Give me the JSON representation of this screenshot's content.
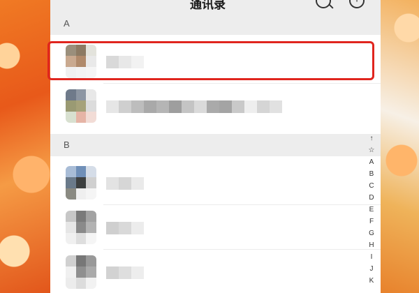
{
  "header": {
    "title": "通讯录",
    "search_icon": "search-icon",
    "add_icon": "add-icon",
    "add_glyph": "+"
  },
  "sections": [
    {
      "letter": "A",
      "contacts": [
        {
          "name": "",
          "avatar_colors": [
            "#9a8f7c",
            "#8c7a63",
            "#e3e3dc",
            "#c9a98f",
            "#b08a6b",
            "#e9e9e9",
            "#f0f0f0",
            "#f3f3f3",
            "#f5f5f5"
          ],
          "name_colors": [
            "#d9d9d9",
            "#e8e8e8",
            "#f2f2f2"
          ],
          "highlighted": true
        },
        {
          "name": "",
          "avatar_colors": [
            "#6f7a8a",
            "#8d96a3",
            "#e8e8e8",
            "#9a9a73",
            "#a6a27a",
            "#dcdcdc",
            "#d8e0d0",
            "#e6b4a6",
            "#f2dcd6"
          ],
          "name_colors": [
            "#e6e6e6",
            "#cfcfcf",
            "#bdbdbd",
            "#a9a9a9",
            "#b5b5b5",
            "#9e9e9e",
            "#c4c4c4",
            "#dadada",
            "#aaaaaa",
            "#a4a4a4",
            "#c9c9c9",
            "#eeeeee",
            "#d5d5d5",
            "#e1e1e1"
          ],
          "highlighted": false
        }
      ]
    },
    {
      "letter": "B",
      "contacts": [
        {
          "name": "",
          "avatar_colors": [
            "#a8bcd6",
            "#6f8fb8",
            "#d5dde8",
            "#6a7a8a",
            "#3d4040",
            "#d0d0d0",
            "#8a8a82",
            "#efefef",
            "#f5f5f5"
          ],
          "name_colors": [
            "#e3e3e3",
            "#d6d6d6",
            "#eaeaea"
          ],
          "highlighted": false
        },
        {
          "name": "",
          "avatar_colors": [
            "#c7c7c7",
            "#7a7a7a",
            "#a3a3a3",
            "#e6e6e6",
            "#8a8a8a",
            "#b3b3b3",
            "#f0f0f0",
            "#dedede",
            "#f5f5f5"
          ],
          "name_colors": [
            "#cfcfcf",
            "#d9d9d9",
            "#ececec"
          ],
          "highlighted": false
        },
        {
          "name": "",
          "avatar_colors": [
            "#d0d0d0",
            "#777777",
            "#999999",
            "#f0f0f0",
            "#8f8f8f",
            "#aaaaaa",
            "#ececec",
            "#dcdcdc",
            "#f2f2f2"
          ],
          "name_colors": [
            "#d2d2d2",
            "#dedede",
            "#ededed"
          ],
          "highlighted": false
        }
      ]
    }
  ],
  "index_bar": [
    "↑",
    "☆",
    "A",
    "B",
    "C",
    "D",
    "E",
    "F",
    "G",
    "H",
    "I",
    "J",
    "K"
  ],
  "colors": {
    "highlight": "#e0251e",
    "section_bg": "#ededed",
    "orange_bg": "#e8591a"
  }
}
